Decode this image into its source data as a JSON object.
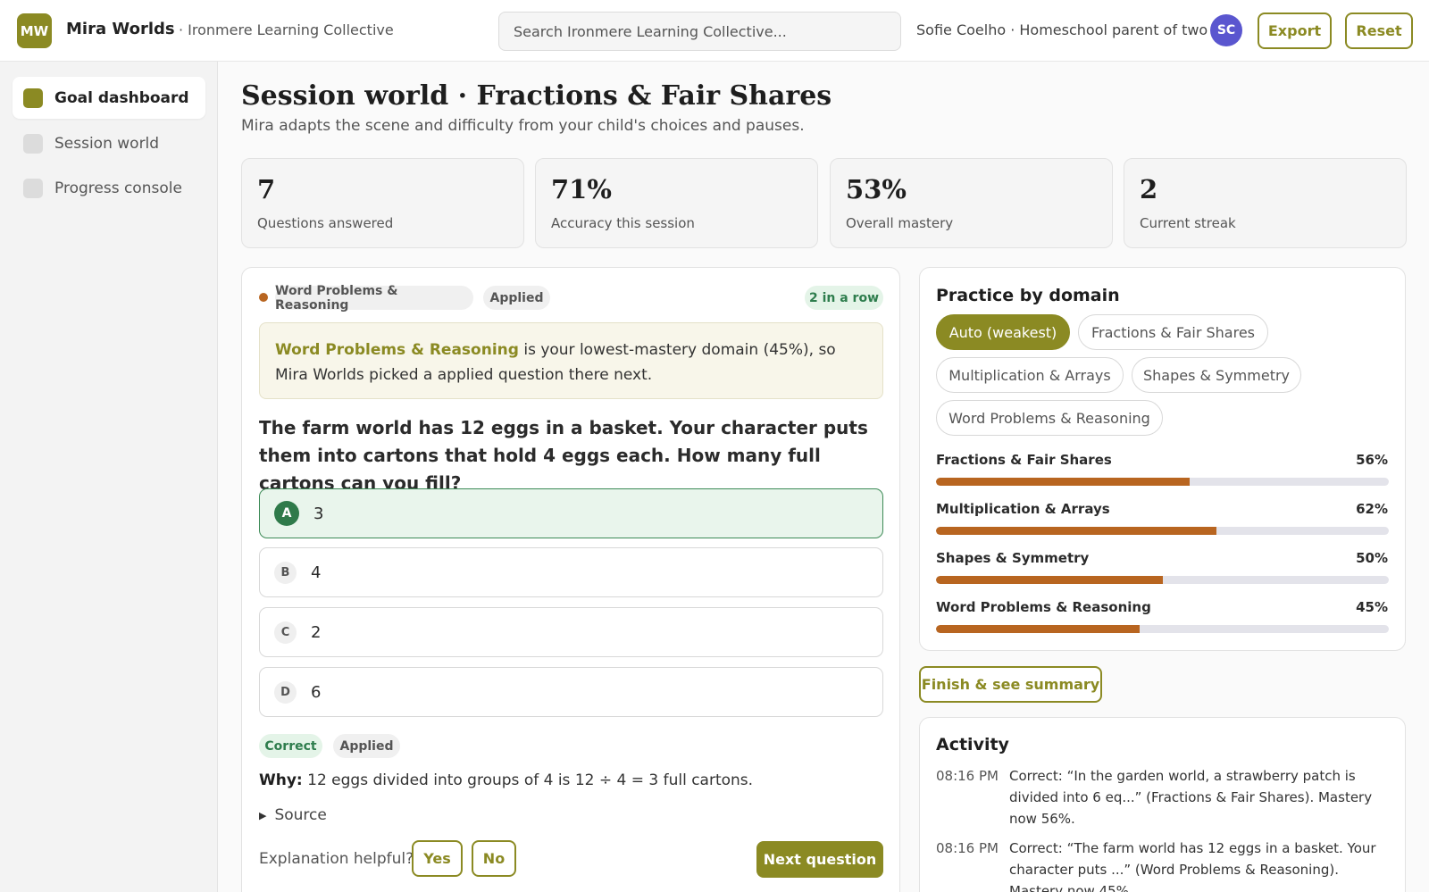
{
  "header": {
    "logo_text": "MW",
    "app_name": "Mira Worlds",
    "org_name": "· Ironmere Learning Collective",
    "search_placeholder": "Search Ironmere Learning Collective...",
    "user_text": "Sofie Coelho · Homeschool parent of two",
    "avatar_initials": "SC",
    "export_label": "Export",
    "reset_label": "Reset"
  },
  "sidebar": {
    "items": [
      {
        "label": "Goal dashboard",
        "active": true
      },
      {
        "label": "Session world",
        "active": false
      },
      {
        "label": "Progress console",
        "active": false
      }
    ]
  },
  "page": {
    "title": "Session world · Fractions & Fair Shares",
    "subtitle": "Mira adapts the scene and difficulty from your child's choices and pauses."
  },
  "stats": [
    {
      "value": "7",
      "label": "Questions answered"
    },
    {
      "value": "71%",
      "label": "Accuracy this session"
    },
    {
      "value": "53%",
      "label": "Overall mastery"
    },
    {
      "value": "2",
      "label": "Current streak"
    }
  ],
  "question_card": {
    "domain_tag": "Word Problems & Reasoning",
    "level_tag": "Applied",
    "streak": "2 in a row",
    "note_highlight": "Word Problems & Reasoning",
    "note_text": " is your lowest-mastery domain (45%), so Mira Worlds picked a applied question there next.",
    "question": "The farm world has 12 eggs in a basket. Your character puts them into cartons that hold 4 eggs each. How many full cartons can you fill?",
    "options": [
      {
        "letter": "A",
        "text": "3",
        "correct": true
      },
      {
        "letter": "B",
        "text": "4",
        "correct": false
      },
      {
        "letter": "C",
        "text": "2",
        "correct": false
      },
      {
        "letter": "D",
        "text": "6",
        "correct": false
      }
    ],
    "result_badge": "Correct",
    "result_level": "Applied",
    "why_label": "Why:",
    "why_text": " 12 eggs divided into groups of 4 is 12 ÷ 4 = 3 full cartons.",
    "source_label": "Source",
    "helpful_label": "Explanation helpful?",
    "yes_label": "Yes",
    "no_label": "No",
    "next_label": "Next question"
  },
  "practice": {
    "title": "Practice by domain",
    "chips": [
      {
        "label": "Auto (weakest)",
        "active": true
      },
      {
        "label": "Fractions & Fair Shares",
        "active": false
      },
      {
        "label": "Multiplication & Arrays",
        "active": false
      },
      {
        "label": "Shapes & Symmetry",
        "active": false
      },
      {
        "label": "Word Problems & Reasoning",
        "active": false
      }
    ],
    "mastery": [
      {
        "label": "Fractions & Fair Shares",
        "pct_label": "56%",
        "value": 56
      },
      {
        "label": "Multiplication & Arrays",
        "pct_label": "62%",
        "value": 62
      },
      {
        "label": "Shapes & Symmetry",
        "pct_label": "50%",
        "value": 50
      },
      {
        "label": "Word Problems & Reasoning",
        "pct_label": "45%",
        "value": 45
      }
    ],
    "bar_color": "#b86520"
  },
  "finish_label": "Finish & see summary",
  "activity": {
    "title": "Activity",
    "items": [
      {
        "time": "08:16 PM",
        "text": "Correct: “In the garden world, a strawberry patch is divided into 6 eq...” (Fractions & Fair Shares). Mastery now 56%."
      },
      {
        "time": "08:16 PM",
        "text": "Correct: “The farm world has 12 eggs in a basket. Your character puts ...” (Word Problems & Reasoning). Mastery now 45%."
      }
    ]
  },
  "colors": {
    "accent": "#8b8a23",
    "correct": "#2f7a4a",
    "avatar": "#5a56cf",
    "bar": "#b86520"
  }
}
